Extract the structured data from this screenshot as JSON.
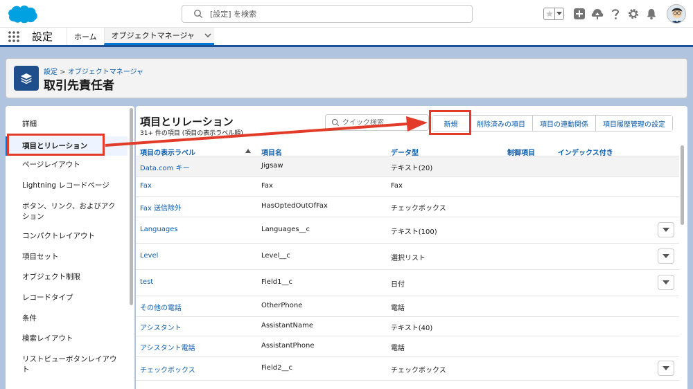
{
  "header": {
    "search_placeholder": "[設定] を検索"
  },
  "context": {
    "app_name": "設定",
    "nav_home": "ホーム",
    "nav_object_manager": "オブジェクトマネージャ"
  },
  "setup_header": {
    "breadcrumb_setup": "設定",
    "breadcrumb_sep": " > ",
    "breadcrumb_object_manager": "オブジェクトマネージャ",
    "title": "取引先責任者"
  },
  "sidebar": {
    "items": [
      {
        "label": "詳細"
      },
      {
        "label": "項目とリレーション"
      },
      {
        "label": "ページレイアウト"
      },
      {
        "label": "Lightning レコードページ"
      },
      {
        "label": "ボタン、リンク、およびアクション"
      },
      {
        "label": "コンパクトレイアウト"
      },
      {
        "label": "項目セット"
      },
      {
        "label": "オブジェクト制限"
      },
      {
        "label": "レコードタイプ"
      },
      {
        "label": "条件"
      },
      {
        "label": "検索レイアウト"
      },
      {
        "label": "リストビューボタンレイアウト"
      }
    ]
  },
  "main": {
    "title": "項目とリレーション",
    "subtitle": "31+ 件の項目 (項目の表示ラベル順)",
    "quick_find_placeholder": "クイック検索",
    "buttons": {
      "new": "新規",
      "deleted_fields": "削除済みの項目",
      "field_dependencies": "項目の連動関係",
      "history_tracking": "項目履歴管理の設定"
    },
    "columns": {
      "label": "項目の表示ラベル",
      "api_name": "項目名",
      "data_type": "データ型",
      "controlling": "制御項目",
      "indexed": "インデックス付き"
    },
    "rows": [
      {
        "label": "Data.com キー",
        "api": "Jigsaw",
        "type": "テキスト(20)",
        "menu": false
      },
      {
        "label": "Fax",
        "api": "Fax",
        "type": "Fax",
        "menu": false
      },
      {
        "label": "Fax 送信除外",
        "api": "HasOptedOutOfFax",
        "type": "チェックボックス",
        "menu": false
      },
      {
        "label": "Languages",
        "api": "Languages__c",
        "type": "テキスト(100)",
        "menu": true
      },
      {
        "label": "Level",
        "api": "Level__c",
        "type": "選択リスト",
        "menu": true
      },
      {
        "label": "test",
        "api": "Field1__c",
        "type": "日付",
        "menu": true
      },
      {
        "label": "その他の電話",
        "api": "OtherPhone",
        "type": "電話",
        "menu": false
      },
      {
        "label": "アシスタント",
        "api": "AssistantName",
        "type": "テキスト(40)",
        "menu": false
      },
      {
        "label": "アシスタント電話",
        "api": "AssistantPhone",
        "type": "電話",
        "menu": false
      },
      {
        "label": "チェックボックス",
        "api": "Field2__c",
        "type": "チェックボックス",
        "menu": true
      }
    ]
  },
  "colors": {
    "brand_blue": "#0176d3",
    "link_blue": "#0b5cab",
    "annotation_red": "#e33b2a"
  }
}
